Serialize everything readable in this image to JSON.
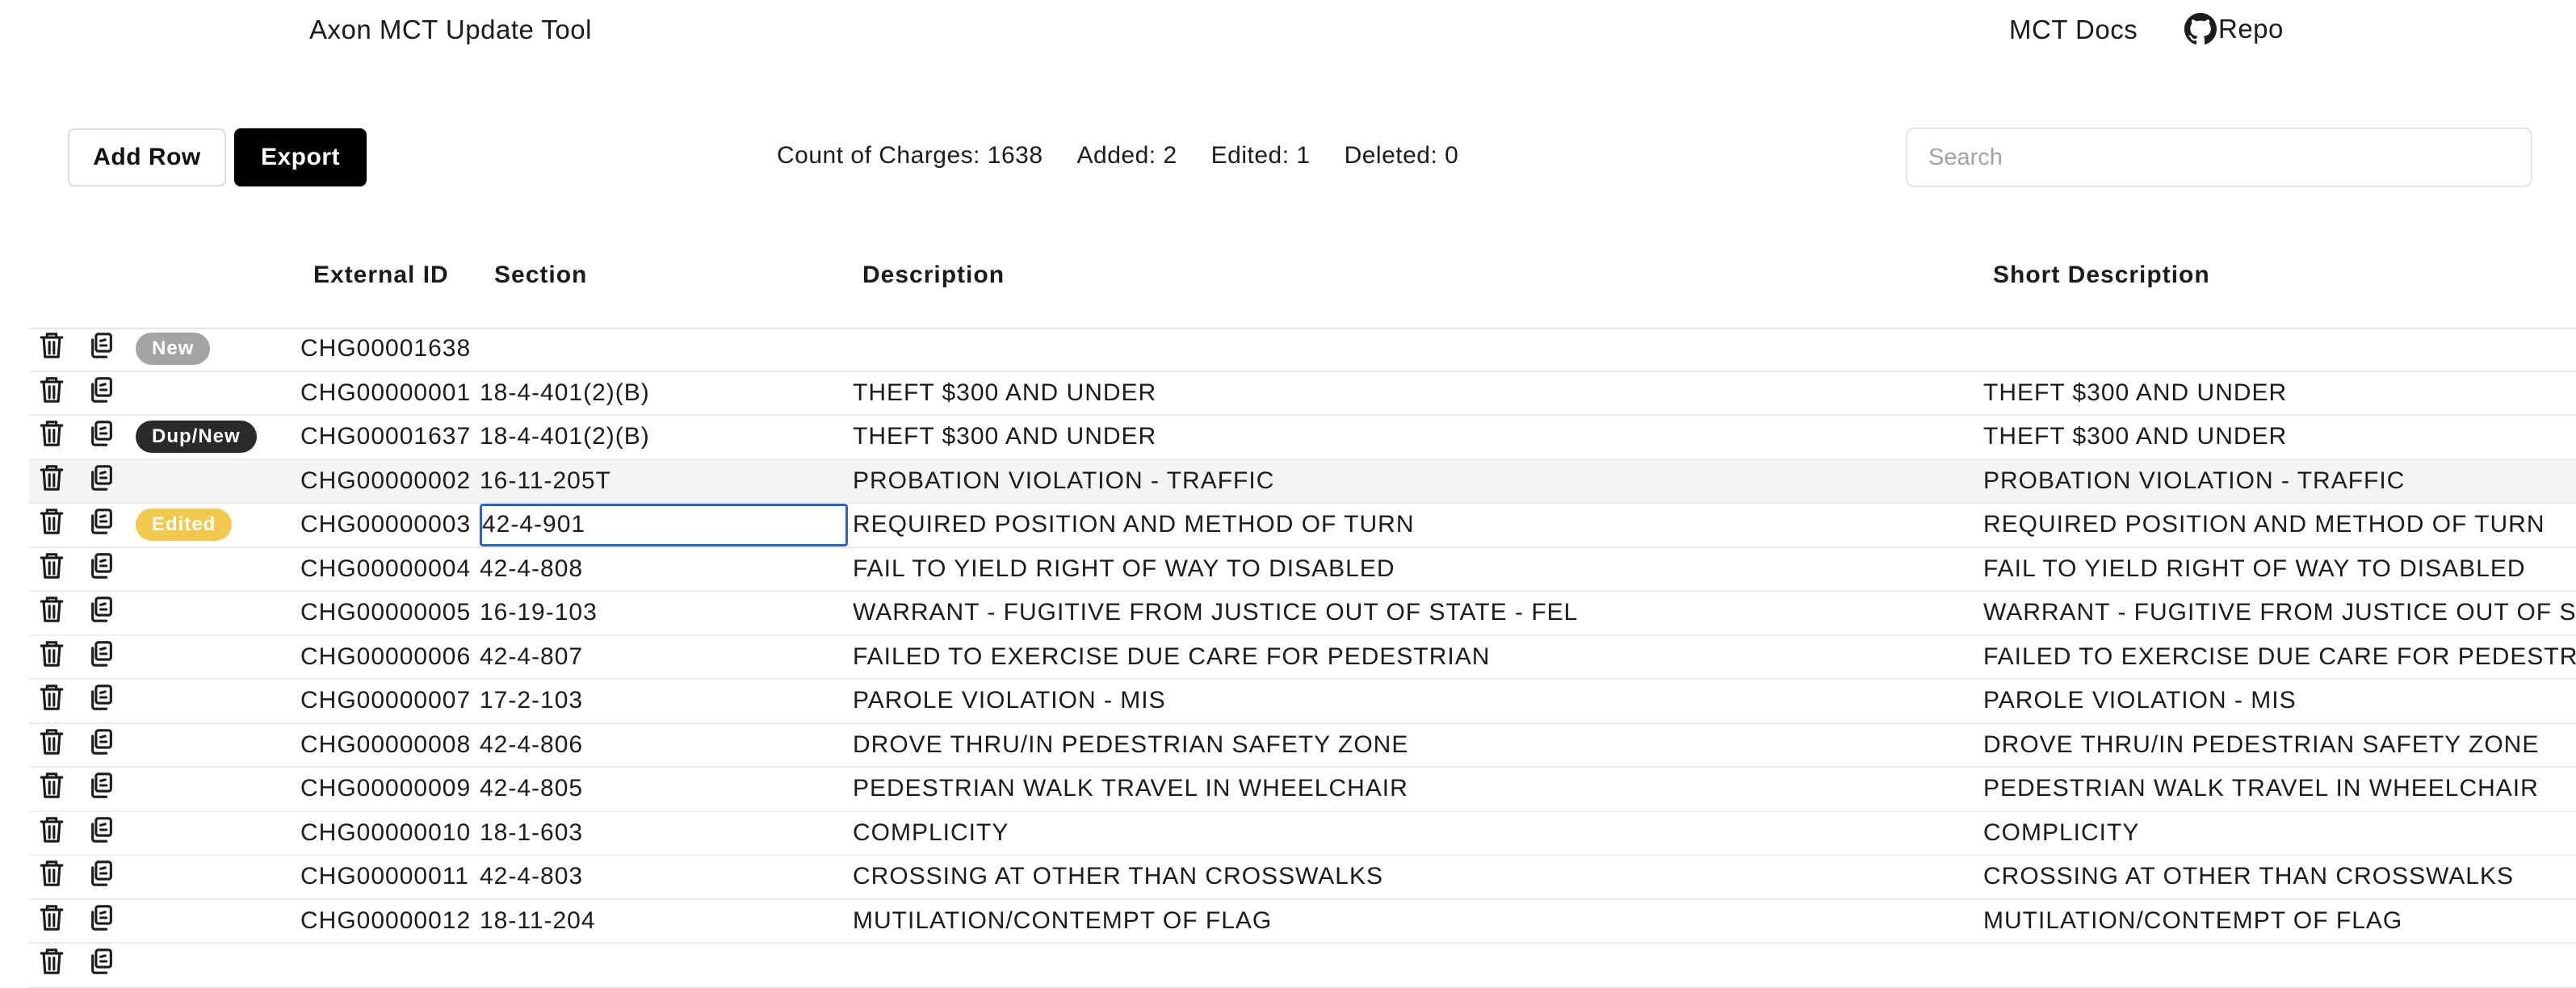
{
  "header": {
    "title": "Axon MCT Update Tool",
    "docs_link": "MCT Docs",
    "repo_link": "Repo",
    "repo_icon": "github-icon"
  },
  "toolbar": {
    "add_row_label": "Add Row",
    "export_label": "Export",
    "search_placeholder": "Search",
    "search_value": ""
  },
  "stats": {
    "count": "Count of Charges: 1638",
    "added": "Added: 2",
    "edited": "Edited: 1",
    "deleted": "Deleted: 0"
  },
  "table": {
    "headers": [
      "External ID",
      "Section",
      "Description",
      "Short Description"
    ],
    "rows": [
      {
        "badge": "New",
        "ext": "CHG00001638",
        "sec": "",
        "desc": "",
        "short": ""
      },
      {
        "badge": "",
        "ext": "CHG00000001",
        "sec": "18-4-401(2)(B)",
        "desc": "THEFT $300 AND UNDER",
        "short": "THEFT $300 AND UNDER"
      },
      {
        "badge": "Dup/New",
        "ext": "CHG00001637",
        "sec": "18-4-401(2)(B)",
        "desc": "THEFT $300 AND UNDER",
        "short": "THEFT $300 AND UNDER"
      },
      {
        "badge": "",
        "ext": "CHG00000002",
        "sec": "16-11-205T",
        "desc": "PROBATION VIOLATION - TRAFFIC",
        "short": "PROBATION VIOLATION - TRAFFIC"
      },
      {
        "badge": "Edited",
        "ext": "CHG00000003",
        "sec": "42-4-901",
        "desc": "REQUIRED POSITION AND METHOD OF TURN",
        "short": "REQUIRED POSITION AND METHOD OF TURN"
      },
      {
        "badge": "",
        "ext": "CHG00000004",
        "sec": "42-4-808",
        "desc": "FAIL TO YIELD RIGHT OF WAY TO DISABLED",
        "short": "FAIL TO YIELD RIGHT OF WAY TO DISABLED"
      },
      {
        "badge": "",
        "ext": "CHG00000005",
        "sec": "16-19-103",
        "desc": "WARRANT - FUGITIVE FROM JUSTICE OUT OF STATE - FEL",
        "short": "WARRANT - FUGITIVE FROM JUSTICE OUT OF STA"
      },
      {
        "badge": "",
        "ext": "CHG00000006",
        "sec": "42-4-807",
        "desc": "FAILED TO EXERCISE DUE CARE FOR PEDESTRIAN",
        "short": "FAILED TO EXERCISE DUE CARE FOR PEDESTRIAN"
      },
      {
        "badge": "",
        "ext": "CHG00000007",
        "sec": "17-2-103",
        "desc": "PAROLE VIOLATION - MIS",
        "short": "PAROLE VIOLATION - MIS"
      },
      {
        "badge": "",
        "ext": "CHG00000008",
        "sec": "42-4-806",
        "desc": "DROVE THRU/IN PEDESTRIAN SAFETY ZONE",
        "short": "DROVE THRU/IN PEDESTRIAN SAFETY ZONE"
      },
      {
        "badge": "",
        "ext": "CHG00000009",
        "sec": "42-4-805",
        "desc": "PEDESTRIAN WALK TRAVEL IN WHEELCHAIR",
        "short": "PEDESTRIAN WALK TRAVEL IN WHEELCHAIR"
      },
      {
        "badge": "",
        "ext": "CHG00000010",
        "sec": "18-1-603",
        "desc": "COMPLICITY",
        "short": "COMPLICITY"
      },
      {
        "badge": "",
        "ext": "CHG00000011",
        "sec": "42-4-803",
        "desc": "CROSSING AT OTHER THAN CROSSWALKS",
        "short": "CROSSING AT OTHER THAN CROSSWALKS"
      },
      {
        "badge": "",
        "ext": "CHG00000012",
        "sec": "18-11-204",
        "desc": "MUTILATION/CONTEMPT OF FLAG",
        "short": "MUTILATION/CONTEMPT OF FLAG"
      },
      {
        "badge": "",
        "ext": "",
        "sec": "",
        "desc": "",
        "short": ""
      }
    ],
    "row_actions": [
      "trash-icon",
      "copy-icon"
    ]
  }
}
